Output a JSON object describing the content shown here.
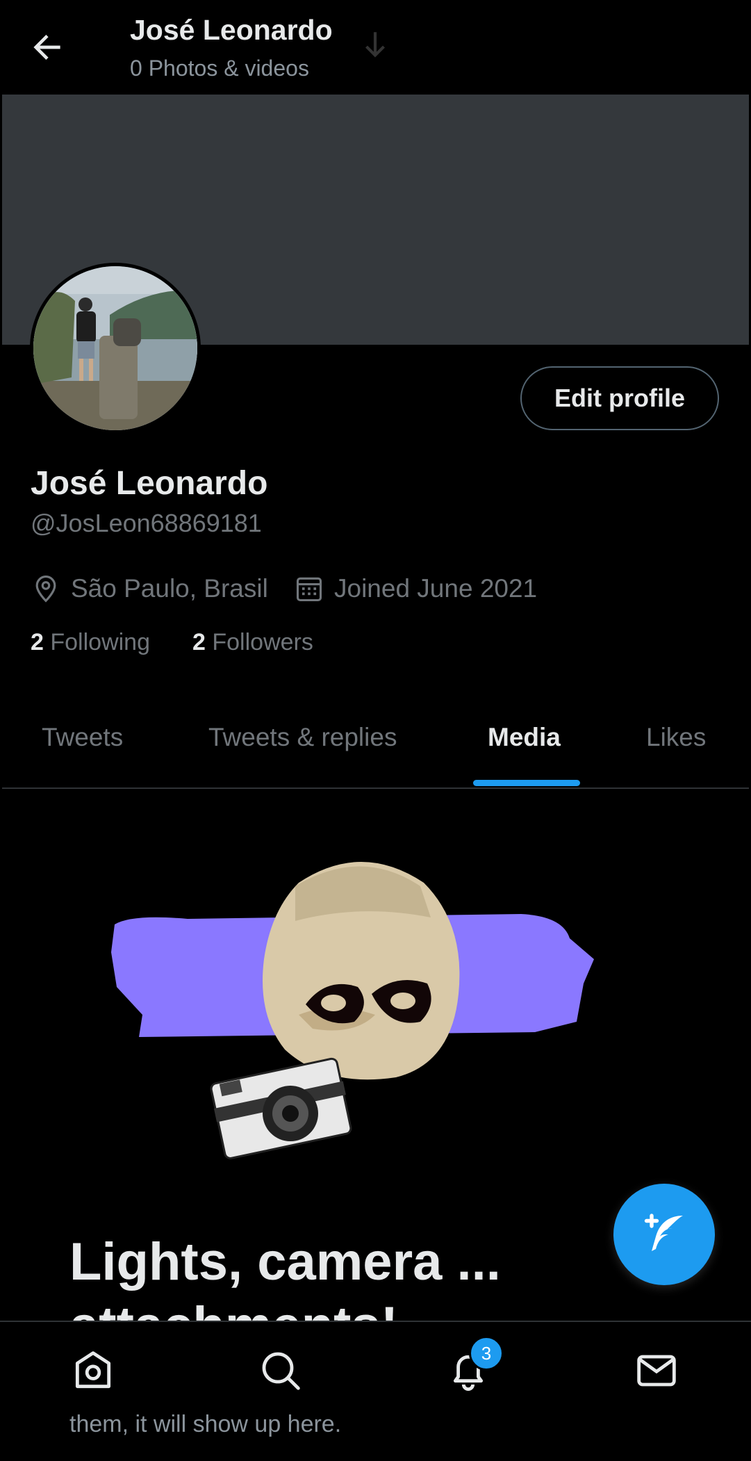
{
  "header": {
    "title": "José Leonardo",
    "subtitle": "0 Photos & videos"
  },
  "profile": {
    "edit_label": "Edit profile",
    "name": "José Leonardo",
    "handle": "@JosLeon68869181",
    "location": "São Paulo, Brasil",
    "joined": "Joined June 2021",
    "following_count": "2",
    "following_label": "Following",
    "followers_count": "2",
    "followers_label": "Followers"
  },
  "tabs": [
    {
      "label": "Tweets"
    },
    {
      "label": "Tweets & replies"
    },
    {
      "label": "Media",
      "active": true
    },
    {
      "label": "Likes"
    }
  ],
  "empty_state": {
    "title": "Lights, camera ... attachments!",
    "body_visible": "them, it will show up here."
  },
  "nav": {
    "notifications_badge": "3"
  },
  "colors": {
    "accent": "#1d9bf0",
    "banner": "#34383c",
    "illustration_purple": "#8a78ff"
  },
  "icons": {
    "back": "arrow-left-icon",
    "location": "location-pin-icon",
    "calendar": "calendar-icon",
    "compose": "compose-feather-icon",
    "home": "home-icon",
    "search": "search-icon",
    "notifications": "bell-icon",
    "messages": "mail-icon"
  }
}
